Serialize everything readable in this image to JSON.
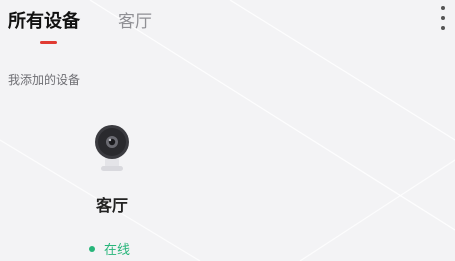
{
  "header": {
    "tabs": [
      {
        "label": "所有设备",
        "active": true
      },
      {
        "label": "客厅",
        "active": false
      }
    ],
    "menu_icon": "more-vertical-icon"
  },
  "section": {
    "title": "我添加的设备"
  },
  "devices": [
    {
      "name": "客厅",
      "icon": "camera-icon",
      "status": "在线"
    }
  ],
  "colors": {
    "accent": "#e03a32",
    "online": "#27b57a",
    "background": "#f3f3f5"
  }
}
